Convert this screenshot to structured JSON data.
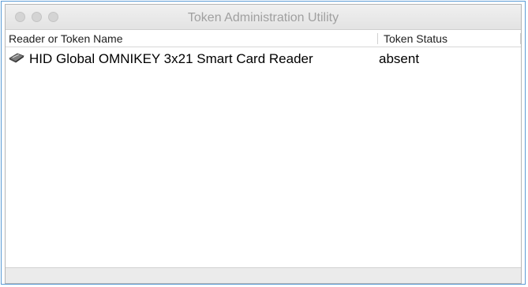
{
  "window": {
    "title": "Token Administration Utility"
  },
  "table": {
    "columns": [
      "Reader or Token Name",
      "Token Status"
    ],
    "rows": [
      {
        "icon": "card-reader-icon",
        "name": "HID Global OMNIKEY 3x21 Smart Card Reader",
        "status": "absent"
      }
    ]
  },
  "colors": {
    "outer_border": "#5b9bd5",
    "traffic_light": "#d4d4d4",
    "title_text": "#a0a0a0"
  }
}
